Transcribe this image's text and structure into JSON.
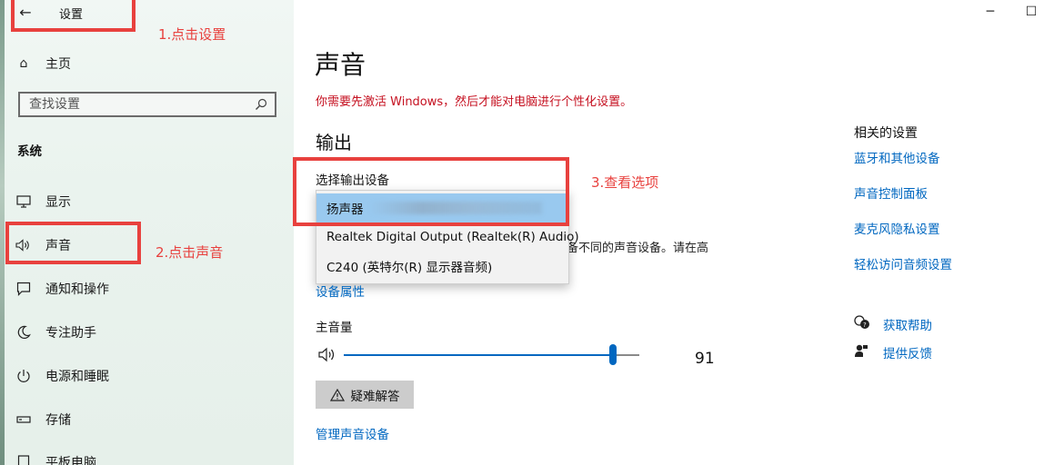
{
  "window": {
    "title": "设置",
    "minimize_glyph": "─",
    "maximize_glyph": "☐"
  },
  "sidebar": {
    "home": "主页",
    "search_placeholder": "查找设置",
    "section": "系统",
    "items": [
      {
        "label": "显示",
        "icon": "monitor-icon"
      },
      {
        "label": "声音",
        "icon": "speaker-icon"
      },
      {
        "label": "通知和操作",
        "icon": "notification-icon"
      },
      {
        "label": "专注助手",
        "icon": "moon-icon"
      },
      {
        "label": "电源和睡眠",
        "icon": "power-icon"
      },
      {
        "label": "存储",
        "icon": "storage-icon"
      },
      {
        "label": "平板电脑",
        "icon": "tablet-icon"
      }
    ]
  },
  "annotations": {
    "step1": "1.点击设置",
    "step2": "2.点击声音",
    "step3": "3.查看选项"
  },
  "main": {
    "title": "声音",
    "activation_warning": "你需要先激活 Windows，然后才能对电脑进行个性化设置。",
    "output_heading": "输出",
    "choose_output_label": "选择输出设备",
    "dropdown_options": [
      "扬声器",
      "Realtek Digital Output (Realtek(R) Audio)",
      "C240 (英特尔(R) 显示器音频)"
    ],
    "partial_hint": "备不同的声音设备。请在高",
    "device_properties_link": "设备属性",
    "master_volume_label": "主音量",
    "volume_value": "91",
    "volume_fraction": 0.91,
    "troubleshoot_button": "疑难解答",
    "manage_devices_link": "管理声音设备"
  },
  "related": {
    "title": "相关的设置",
    "links": [
      "蓝牙和其他设备",
      "声音控制面板",
      "麦克风隐私设置",
      "轻松访问音频设置"
    ],
    "help": "获取帮助",
    "feedback": "提供反馈"
  },
  "colors": {
    "accent": "#0067c0",
    "annotation_red": "#e8413e",
    "warning": "#c50f1f"
  }
}
